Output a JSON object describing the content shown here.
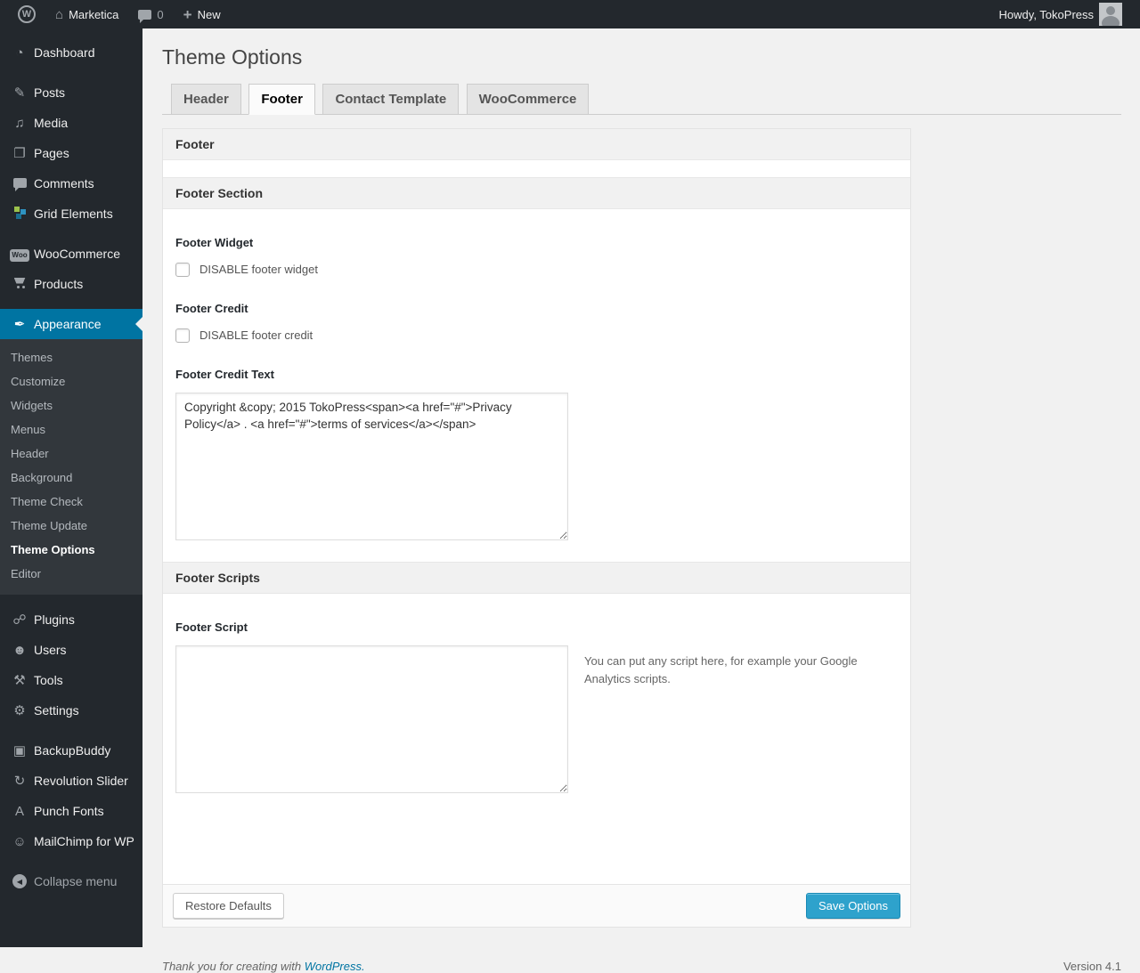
{
  "admin_bar": {
    "site_name": "Marketica",
    "comment_count": "0",
    "new_label": "New",
    "howdy": "Howdy, TokoPress"
  },
  "icons": {
    "wp_logo": "W",
    "home": "⌂",
    "plus": "+",
    "dashboard": "◔",
    "posts": "✎",
    "media": "♫",
    "pages": "❐",
    "woocommerce": "Woo",
    "appearance": "✒",
    "plugins": "☍",
    "users": "☻",
    "tools": "⚒",
    "settings": "⚙",
    "backupbuddy": "▣",
    "revslider": "↻",
    "punchfonts": "A",
    "mailchimp": "☺",
    "collapse": "◀"
  },
  "sidebar": {
    "items": [
      {
        "label": "Dashboard"
      },
      {
        "label": "Posts"
      },
      {
        "label": "Media"
      },
      {
        "label": "Pages"
      },
      {
        "label": "Comments"
      },
      {
        "label": "Grid Elements"
      },
      {
        "label": "WooCommerce"
      },
      {
        "label": "Products"
      },
      {
        "label": "Appearance"
      },
      {
        "label": "Plugins"
      },
      {
        "label": "Users"
      },
      {
        "label": "Tools"
      },
      {
        "label": "Settings"
      },
      {
        "label": "BackupBuddy"
      },
      {
        "label": "Revolution Slider"
      },
      {
        "label": "Punch Fonts"
      },
      {
        "label": "MailChimp for WP"
      },
      {
        "label": "Collapse menu"
      }
    ],
    "appearance_submenu": [
      {
        "label": "Themes"
      },
      {
        "label": "Customize"
      },
      {
        "label": "Widgets"
      },
      {
        "label": "Menus"
      },
      {
        "label": "Header"
      },
      {
        "label": "Background"
      },
      {
        "label": "Theme Check"
      },
      {
        "label": "Theme Update"
      },
      {
        "label": "Theme Options"
      },
      {
        "label": "Editor"
      }
    ]
  },
  "main": {
    "page_title": "Theme Options",
    "tabs": [
      {
        "label": "Header"
      },
      {
        "label": "Footer"
      },
      {
        "label": "Contact Template"
      },
      {
        "label": "WooCommerce"
      }
    ],
    "panel": {
      "box_title": "Footer",
      "section_title": "Footer Section",
      "fields": {
        "footer_widget_label": "Footer Widget",
        "footer_widget_checkbox": "DISABLE footer widget",
        "footer_credit_label": "Footer Credit",
        "footer_credit_checkbox": "DISABLE footer credit",
        "footer_credit_text_label": "Footer Credit Text",
        "footer_credit_text_value": "Copyright &copy; 2015 TokoPress<span><a href=\"#\">Privacy Policy</a> . <a href=\"#\">terms of services</a></span>",
        "scripts_section_title": "Footer Scripts",
        "footer_script_label": "Footer Script",
        "footer_script_value": "",
        "footer_script_help": "You can put any script here, for example your Google Analytics scripts."
      },
      "buttons": {
        "restore": "Restore Defaults",
        "save": "Save Options"
      }
    },
    "footer": {
      "thanks_prefix": "Thank you for creating with ",
      "wordpress_link": "WordPress.",
      "version": "Version 4.1"
    }
  },
  "colors": {
    "adminbar_bg": "#23282d",
    "menu_highlight": "#0074a2",
    "primary_button": "#2ea2cc",
    "link": "#0074a2",
    "page_bg": "#f1f1f1"
  }
}
